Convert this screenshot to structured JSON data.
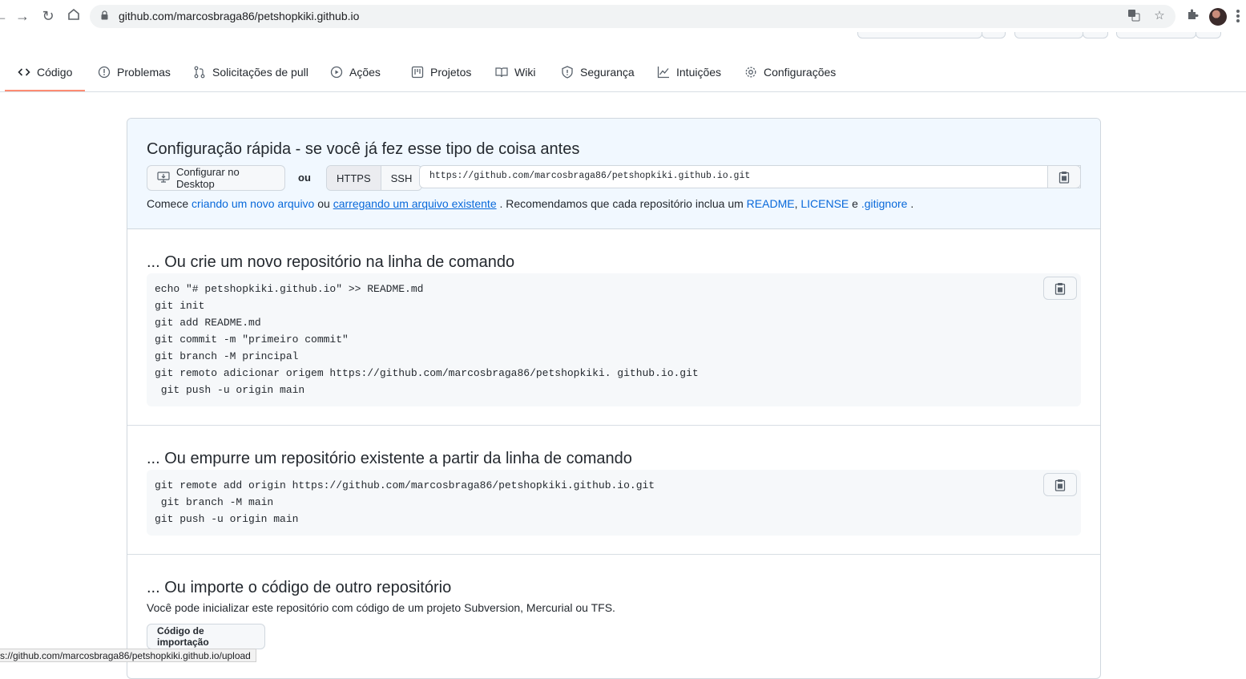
{
  "browser": {
    "url": "github.com/marcosbraga86/petshopkiki.github.io"
  },
  "repo_nav": {
    "tabs": [
      {
        "label": "Código"
      },
      {
        "label": "Problemas"
      },
      {
        "label": "Solicitações de pull"
      },
      {
        "label": "Ações"
      },
      {
        "label": "Projetos"
      },
      {
        "label": "Wiki"
      },
      {
        "label": "Segurança"
      },
      {
        "label": "Intuições"
      },
      {
        "label": "Configurações"
      }
    ]
  },
  "quick_setup": {
    "title": "Configuração rápida - se você já fez esse tipo de coisa antes",
    "desktop_button": "Configurar no Desktop",
    "or": "ou",
    "https_label": "HTTPS",
    "ssh_label": "SSH",
    "clone_url": "https://github.com/marcosbraga86/petshopkiki.github.io.git",
    "intro_start": "Comece",
    "link_new_file": "criando um novo arquivo",
    "or_text": "ou",
    "link_upload": "carregando um arquivo existente",
    "recommend_text": ". Recomendamos que cada repositório inclua um",
    "link_readme": "README",
    "comma": ",",
    "link_license": "LICENSE",
    "and_text": "e",
    "link_gitignore": ".gitignore",
    "period": "."
  },
  "new_repo": {
    "title": "... Ou crie um novo repositório na linha de comando",
    "lines": [
      "echo \"# petshopkiki.github.io\" >> README.md",
      "git init",
      "git add README.md",
      "git commit -m \"primeiro commit\"",
      "git branch -M principal",
      "git remoto adicionar origem https://github.com/marcosbraga86/petshopkiki. github.io.git",
      " git push -u origin main"
    ]
  },
  "push_existing": {
    "title": "... Ou empurre um repositório existente a partir da linha de comando",
    "lines": [
      "git remote add origin https://github.com/marcosbraga86/petshopkiki.github.io.git",
      " git branch -M main",
      "git push -u origin main"
    ]
  },
  "import": {
    "title": "... Ou importe o código de outro repositório",
    "description": "Você pode inicializar este repositório com código de um projeto Subversion, Mercurial ou TFS.",
    "button": "Código de importação"
  },
  "status_bar": {
    "text": "s://github.com/marcosbraga86/petshopkiki.github.io/upload"
  },
  "colors": {
    "accent_link": "#0969da",
    "tab_underline": "#fd8c73",
    "quick_setup_bg": "#f1f8ff"
  }
}
